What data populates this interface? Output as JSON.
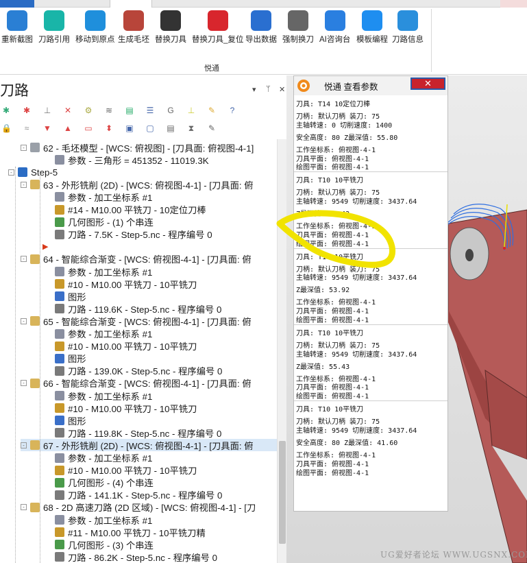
{
  "ribbon": {
    "buttons": [
      {
        "label": "重新截图",
        "icon": "refresh-screenshot-icon",
        "color": "#2a7fd4"
      },
      {
        "label": "刀路引用",
        "icon": "toolpath-reference-icon",
        "color": "#19b5a8"
      },
      {
        "label": "移动到原点",
        "icon": "move-to-origin-icon",
        "color": "#1f8fdc"
      },
      {
        "label": "生成毛坯",
        "icon": "generate-stock-icon",
        "color": "#b8453a"
      },
      {
        "label": "替换刀具",
        "icon": "replace-tool-icon",
        "color": "#333333"
      },
      {
        "label": "替换刀具_复位",
        "icon": "replace-tool-reset-icon",
        "color": "#d8262d"
      },
      {
        "label": "导出数据",
        "icon": "export-data-icon",
        "color": "#2a6fd0"
      },
      {
        "label": "强制换刀",
        "icon": "force-tool-change-icon",
        "color": "#666666"
      },
      {
        "label": "AI咨询台",
        "icon": "ai-console-icon",
        "color": "#2a7fe0"
      },
      {
        "label": "模板编程",
        "icon": "template-programming-icon",
        "color": "#1e8ef0"
      },
      {
        "label": "刀路信息",
        "icon": "toolpath-info-icon",
        "color": "#2a8fdc"
      }
    ],
    "group": "悦通"
  },
  "panel": {
    "title": "刀路",
    "pin": "▾ ⊥ ✕"
  },
  "tree": [
    {
      "text": "62 - 毛坯模型 - [WCS: 俯视图] - [刀具面: 俯视图-4-1]",
      "indent": 44,
      "icon": "stock-model-icon",
      "pm": "-"
    },
    {
      "text": "参数 - 三角形 = 451352 - 11019.3K",
      "indent": 80,
      "icon": "parameters-icon"
    },
    {
      "text": "Step-5",
      "indent": 26,
      "icon": "group-icon",
      "pm": "-"
    },
    {
      "text": "63 - 外形铣削 (2D) - [WCS: 俯视图-4-1] - [刀具面: 俯",
      "indent": 44,
      "icon": "operation-folder-icon",
      "pm": "-"
    },
    {
      "text": "参数 - 加工坐标系 #1",
      "indent": 80,
      "icon": "parameters-icon"
    },
    {
      "text": "#14 - M10.00 平铣刀 - 10定位刀棒",
      "indent": 80,
      "icon": "tool-icon"
    },
    {
      "text": "几何图形 - (1) 个串连",
      "indent": 80,
      "icon": "geometry-icon"
    },
    {
      "text": "刀路 - 7.5K - Step-5.nc - 程序编号 0",
      "indent": 80,
      "icon": "toolpath-icon"
    },
    {
      "text": "",
      "indent": 62,
      "icon": "insert-arrow-icon"
    },
    {
      "text": "64 - 智能综合渐变 - [WCS: 俯视图-4-1] - [刀具面: 俯",
      "indent": 44,
      "icon": "operation-folder-icon",
      "pm": "-"
    },
    {
      "text": "参数 - 加工坐标系 #1",
      "indent": 80,
      "icon": "parameters-icon"
    },
    {
      "text": "#10 - M10.00 平铣刀 - 10平铣刀",
      "indent": 80,
      "icon": "tool-icon"
    },
    {
      "text": "图形",
      "indent": 80,
      "icon": "solid-icon"
    },
    {
      "text": "刀路 - 119.6K - Step-5.nc - 程序编号 0",
      "indent": 80,
      "icon": "toolpath-icon"
    },
    {
      "text": "65 - 智能综合渐变 - [WCS: 俯视图-4-1] - [刀具面: 俯",
      "indent": 44,
      "icon": "operation-folder-icon",
      "pm": "-"
    },
    {
      "text": "参数 - 加工坐标系 #1",
      "indent": 80,
      "icon": "parameters-icon"
    },
    {
      "text": "#10 - M10.00 平铣刀 - 10平铣刀",
      "indent": 80,
      "icon": "tool-icon"
    },
    {
      "text": "图形",
      "indent": 80,
      "icon": "solid-icon"
    },
    {
      "text": "刀路 - 139.0K - Step-5.nc - 程序编号 0",
      "indent": 80,
      "icon": "toolpath-icon"
    },
    {
      "text": "66 - 智能综合渐变 - [WCS: 俯视图-4-1] - [刀具面: 俯",
      "indent": 44,
      "icon": "operation-folder-icon",
      "pm": "-"
    },
    {
      "text": "参数 - 加工坐标系 #1",
      "indent": 80,
      "icon": "parameters-icon"
    },
    {
      "text": "#10 - M10.00 平铣刀 - 10平铣刀",
      "indent": 80,
      "icon": "tool-icon"
    },
    {
      "text": "图形",
      "indent": 80,
      "icon": "solid-icon"
    },
    {
      "text": "刀路 - 119.8K - Step-5.nc - 程序编号 0",
      "indent": 80,
      "icon": "toolpath-icon"
    },
    {
      "text": "67 - 外形铣削 (2D) - [WCS: 俯视图-4-1] - [刀具面: 俯",
      "indent": 44,
      "icon": "operation-folder-icon",
      "pm": "-",
      "selected": true
    },
    {
      "text": "参数 - 加工坐标系 #1",
      "indent": 80,
      "icon": "parameters-icon"
    },
    {
      "text": "#10 - M10.00 平铣刀 - 10平铣刀",
      "indent": 80,
      "icon": "tool-icon"
    },
    {
      "text": "几何图形 - (4) 个串连",
      "indent": 80,
      "icon": "geometry-icon"
    },
    {
      "text": "刀路 - 141.1K - Step-5.nc - 程序编号 0",
      "indent": 80,
      "icon": "toolpath-icon"
    },
    {
      "text": "68 - 2D 高速刀路 (2D 区域) - [WCS: 俯视图-4-1] - [刀",
      "indent": 44,
      "icon": "operation-folder-icon",
      "pm": "-"
    },
    {
      "text": "参数 - 加工坐标系 #1",
      "indent": 80,
      "icon": "parameters-icon"
    },
    {
      "text": "#11 - M10.00 平铣刀 - 10平铣刀精",
      "indent": 80,
      "icon": "tool-icon"
    },
    {
      "text": "几何图形 - (3) 个串连",
      "indent": 80,
      "icon": "geometry-icon"
    },
    {
      "text": "刀路 - 86.2K - Step-5.nc - 程序编号 0",
      "indent": 80,
      "icon": "toolpath-icon"
    }
  ],
  "popup": {
    "title": "悦通  查看参数",
    "close": "✕",
    "lines": [
      "刀具: T14  10定位刀棒",
      "",
      "刀柄: 默认刀柄 装刀: 75",
      "主轴转速: 0 切削速度: 1400",
      "",
      "安全高度: 80  Z最深值: 55.80",
      "",
      "工作坐标系: 俯视图-4-1",
      "刀具平面: 俯视图-4-1",
      "绘图平面: 俯视图-4-1",
      "---",
      "刀具: T10  10平铣刀",
      "",
      "刀柄: 默认刀柄 装刀: 75",
      "主轴转速: 9549 切削速度: 3437.64",
      "",
      "Z最深值: 55.43",
      "",
      "工作坐标系: 俯视图-4-1",
      "刀具平面: 俯视图-4-1",
      "绘图平面: 俯视图-4-1",
      "---",
      "刀具: T10  10平铣刀",
      "",
      "刀柄: 默认刀柄 装刀: 75",
      "主轴转速: 9549 切削速度: 3437.64",
      "",
      "Z最深值: 53.92",
      "",
      "工作坐标系: 俯视图-4-1",
      "刀具平面: 俯视图-4-1",
      "绘图平面: 俯视图-4-1",
      "---",
      "刀具: T10  10平铣刀",
      "",
      "刀柄: 默认刀柄 装刀: 75",
      "主轴转速: 9549 切削速度: 3437.64",
      "",
      "Z最深值: 55.43",
      "",
      "工作坐标系: 俯视图-4-1",
      "刀具平面: 俯视图-4-1",
      "绘图平面: 俯视图-4-1",
      "---",
      "刀具: T10  10平铣刀",
      "",
      "刀柄: 默认刀柄 装刀: 75",
      "主轴转速: 9549 切削速度: 3437.64",
      "",
      "安全高度: 80  Z最深值: 41.60",
      "",
      "工作坐标系: 俯视图-4-1",
      "刀具平面: 俯视图-4-1",
      "绘图平面: 俯视图-4-1"
    ]
  },
  "watermark": "UG爱好者论坛  WWW.UGSNX.COM",
  "colors": {
    "accent": "#2b6cc4",
    "highlight": "#f1e300",
    "part": "#b55a58",
    "selection": "#d9e8f7"
  }
}
